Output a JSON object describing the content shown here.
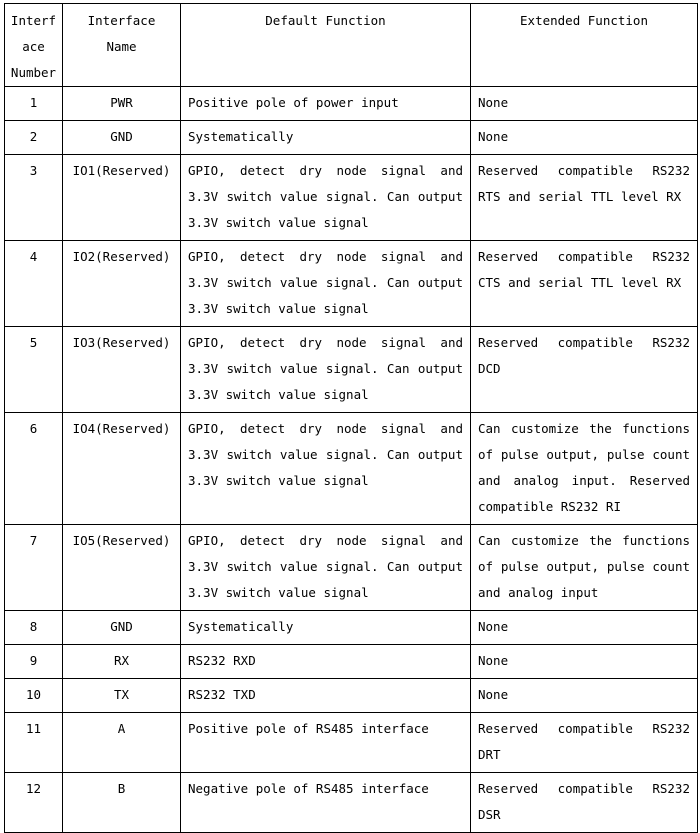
{
  "table": {
    "headers": [
      "Interface Number",
      "Interface Name",
      "Default Function",
      "Extended Function"
    ],
    "header_num_lines": [
      "Interf",
      "ace",
      "Number"
    ],
    "rows": [
      {
        "number": "1",
        "name": "PWR",
        "default_function": "Positive pole of power input",
        "extended_function": "None"
      },
      {
        "number": "2",
        "name": "GND",
        "default_function": "Systematically",
        "extended_function": "None"
      },
      {
        "number": "3",
        "name": "IO1(Reserved)",
        "default_function": "GPIO, detect dry node signal and 3.3V switch value signal. Can output 3.3V switch value signal",
        "extended_function": "Reserved compatible RS232 RTS and serial TTL level RX"
      },
      {
        "number": "4",
        "name": "IO2(Reserved)",
        "default_function": "GPIO, detect dry node signal and 3.3V switch value signal. Can output 3.3V switch value signal",
        "extended_function": "Reserved compatible RS232 CTS and serial TTL level RX"
      },
      {
        "number": "5",
        "name": "IO3(Reserved)",
        "default_function": "GPIO, detect dry node signal and 3.3V switch value signal. Can output 3.3V switch value signal",
        "extended_function": "Reserved compatible RS232 DCD"
      },
      {
        "number": "6",
        "name": "IO4(Reserved)",
        "default_function": "GPIO, detect dry node signal and 3.3V switch value signal. Can output 3.3V switch value signal",
        "extended_function": "Can customize the functions of pulse output, pulse count and analog input. Reserved compatible RS232 RI"
      },
      {
        "number": "7",
        "name": "IO5(Reserved)",
        "default_function": "GPIO, detect dry node signal and 3.3V switch value signal. Can output 3.3V switch value signal",
        "extended_function": "Can customize the functions of pulse output, pulse count and analog input"
      },
      {
        "number": "8",
        "name": "GND",
        "default_function": "Systematically",
        "extended_function": "None"
      },
      {
        "number": "9",
        "name": "RX",
        "default_function": "RS232 RXD",
        "extended_function": "None"
      },
      {
        "number": "10",
        "name": "TX",
        "default_function": "RS232 TXD",
        "extended_function": "None"
      },
      {
        "number": "11",
        "name": "A",
        "default_function": "Positive pole of RS485 interface",
        "extended_function": "Reserved compatible RS232 DRT"
      },
      {
        "number": "12",
        "name": "B",
        "default_function": "Negative pole of RS485 interface",
        "extended_function": "Reserved compatible RS232 DSR"
      }
    ]
  },
  "style": {
    "border_color": "#000000",
    "text_color": "#000000",
    "background": "#ffffff"
  }
}
